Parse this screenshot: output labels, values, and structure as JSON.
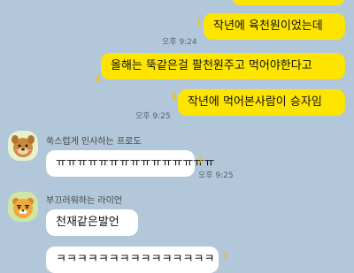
{
  "messages": {
    "m1": {
      "text": "작년에 육천원이었는데",
      "unread": "1",
      "time": "오후 9:24"
    },
    "m2": {
      "text": "올해는 뚝같은걸 팔천원주고 먹어야한다고",
      "unread": "1"
    },
    "m3": {
      "text": "작년에 먹어본사람이 승자임",
      "unread": "1",
      "time": "오후 9:25"
    },
    "m4": {
      "sender": "쑥스럽게 인사하는 프로도",
      "text": "ㅠㅠㅠㅠㅠㅠㅠㅠㅠㅠㅠㅠㅠㅠㅠ",
      "unread": "1",
      "time": "오후 9:25"
    },
    "m5": {
      "sender": "부끄러워하는 라이언",
      "text": "천재같은발언"
    },
    "m6": {
      "text": "ㅋㅋㅋㅋㅋㅋㅋㅋㅋㅋㅋㅋㅋㅋㅋ",
      "unread": "1"
    }
  },
  "colors": {
    "background": "#b2c7d9",
    "my_bubble": "#fee500",
    "their_bubble": "#ffffff",
    "unread": "#f0c400"
  },
  "icons": {
    "frodo": "frodo-avatar-icon",
    "ryan": "ryan-avatar-icon"
  }
}
